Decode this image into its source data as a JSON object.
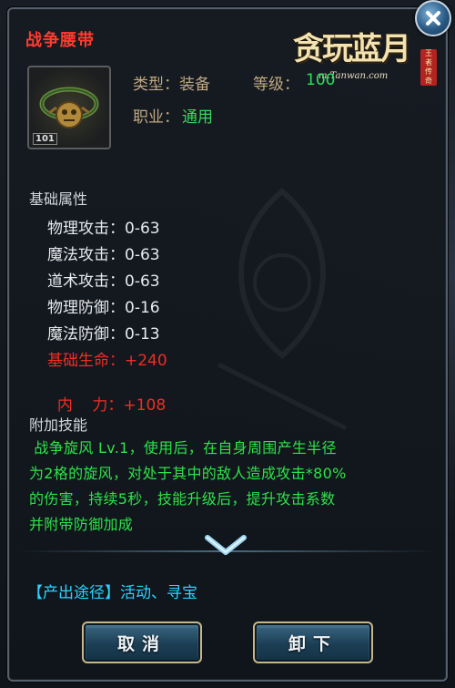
{
  "item": {
    "name": "战争腰带",
    "icon": "belt-with-skull-icon",
    "icon_badge": "lvl-badge",
    "type_label": "类型：装备",
    "level_label": "等级：",
    "level_value": "100",
    "class_label": "职业：",
    "class_value": "通用"
  },
  "base_attrs": {
    "title": "基础属性",
    "rows": [
      {
        "label": "物理攻击：",
        "value": "0-63"
      },
      {
        "label": "魔法攻击：",
        "value": "0-63"
      },
      {
        "label": "道术攻击：",
        "value": "0-63"
      },
      {
        "label": "物理防御：",
        "value": "0-16"
      },
      {
        "label": "魔法防御：",
        "value": "0-13"
      },
      {
        "label": "基础生命：",
        "value": "+240"
      },
      {
        "label": "内    力：",
        "value": "+108"
      }
    ]
  },
  "extra_skill": {
    "title": "附加技能",
    "lines": [
      " 战争旋风 Lv.1，使用后，在自身周围产生半径",
      "为2格的旋风，对处于其中的敌人造成攻击*80%",
      "的伤害，持续5秒，技能升级后，提升攻击系数",
      "并附带防御加成"
    ]
  },
  "source": {
    "text": "【产出途径】活动、寻宝"
  },
  "buttons": {
    "cancel": "取消",
    "unequip": "卸下"
  },
  "logo": {
    "title": "贪玩蓝月",
    "domain": "m.Tanwan.com",
    "seal": "王者传奇"
  },
  "colors": {
    "name_red": "#ff3b2f",
    "label_tan": "#bfa882",
    "value_green": "#27e35a",
    "stat_red": "#ef2d25",
    "source_cyan": "#2ad3ff",
    "button_border": "#c7b689"
  }
}
